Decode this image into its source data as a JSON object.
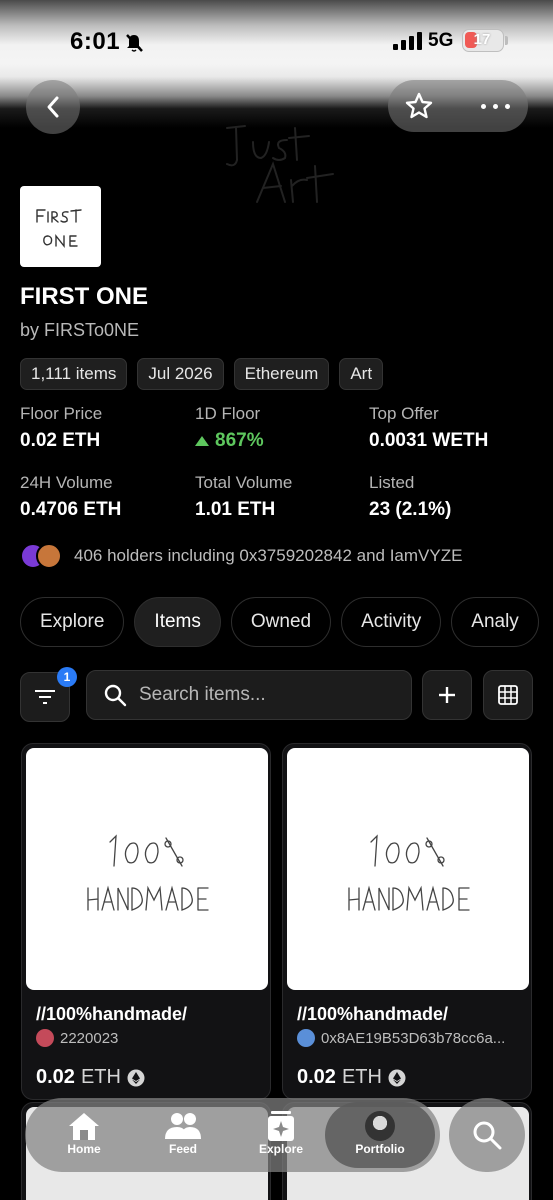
{
  "status_bar": {
    "time": "6:01",
    "network": "5G",
    "battery": "17"
  },
  "collection": {
    "banner_text": "Just Art",
    "avatar_text": "FIRST ONE",
    "name": "FIRST ONE",
    "creator": "by FIRSTo0NE",
    "chips": [
      "1,111 items",
      "Jul 2026",
      "Ethereum",
      "Art"
    ],
    "stats": [
      {
        "label": "Floor Price",
        "value": "0.02 ETH"
      },
      {
        "label": "1D Floor",
        "value": "867%"
      },
      {
        "label": "Top Offer",
        "value": "0.0031 WETH"
      },
      {
        "label": "24H Volume",
        "value": "0.4706 ETH"
      },
      {
        "label": "Total Volume",
        "value": "1.01 ETH"
      },
      {
        "label": "Listed",
        "value": "23 (2.1%)"
      }
    ],
    "holders_text": "406 holders including 0x3759202842 and IamVYZE"
  },
  "tabs": [
    "Explore",
    "Items",
    "Owned",
    "Activity",
    "Analy"
  ],
  "active_tab": "Items",
  "toolbar": {
    "filter_count": "1",
    "search_placeholder": "Search items..."
  },
  "items": [
    {
      "image_text": "100% HANDMADE",
      "name": "//100%handmade/",
      "owner": "2220023",
      "price": "0.02",
      "currency": "ETH"
    },
    {
      "image_text": "100% HANDMADE",
      "name": "//100%handmade/",
      "owner": "0x8AE19B53D63b78cc6a...",
      "price": "0.02",
      "currency": "ETH"
    }
  ],
  "nav": {
    "home": "Home",
    "feed": "Feed",
    "explore": "Explore",
    "portfolio": "Portfolio"
  },
  "colors": {
    "accent_green": "#5ec75e",
    "badge_blue": "#2a7bf6"
  }
}
